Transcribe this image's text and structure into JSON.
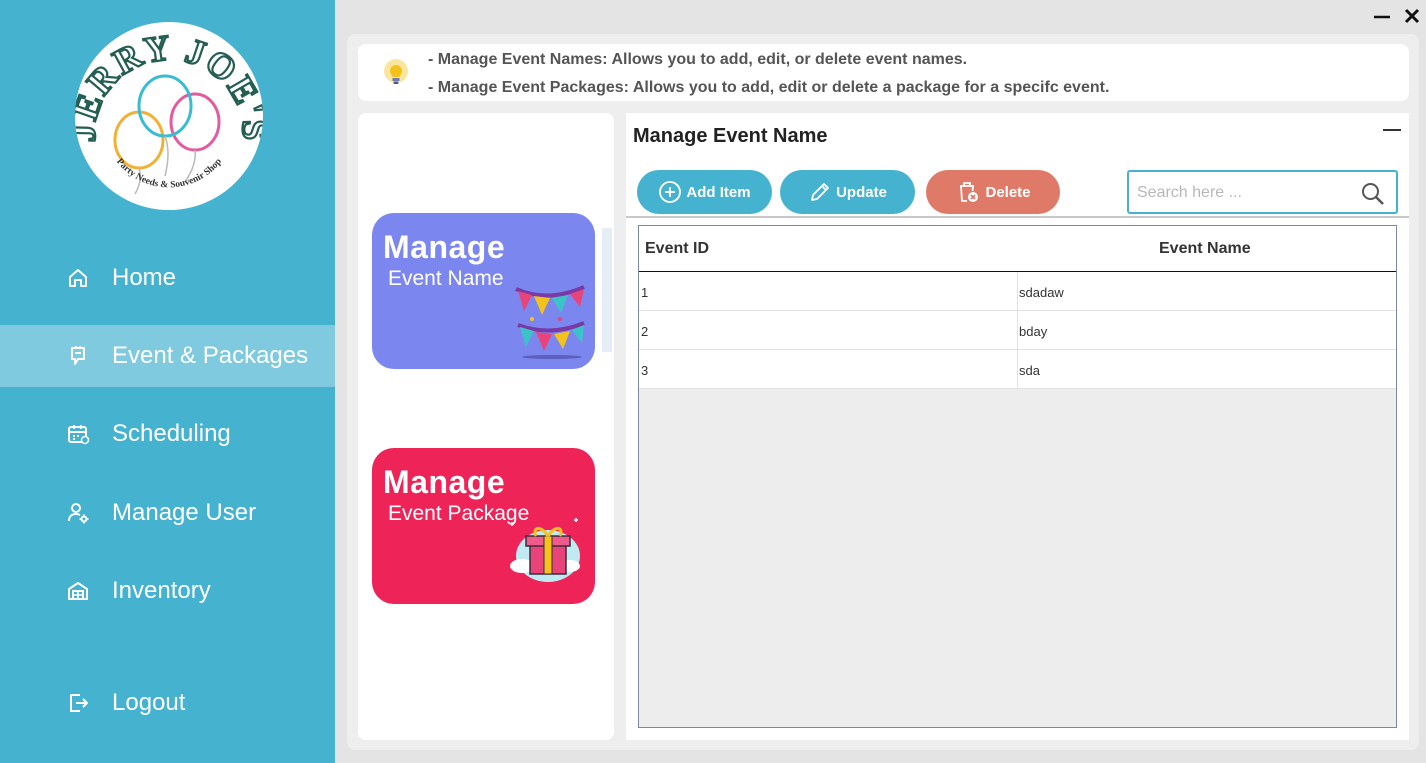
{
  "window": {
    "minimize_icon": "minimize-icon",
    "close_icon": "close-icon"
  },
  "logo": {
    "brand_text": "JERRY JOE'S",
    "tagline": "Party Needs & Souvenir Shop"
  },
  "sidebar": {
    "items": [
      {
        "label": "Home",
        "icon": "home-icon",
        "active": false
      },
      {
        "label": "Event & Packages",
        "icon": "event-packages-icon",
        "active": true
      },
      {
        "label": "Scheduling",
        "icon": "calendar-icon",
        "active": false
      },
      {
        "label": "Manage User",
        "icon": "user-settings-icon",
        "active": false
      },
      {
        "label": "Inventory",
        "icon": "warehouse-icon",
        "active": false
      }
    ],
    "logout": {
      "label": "Logout",
      "icon": "logout-icon"
    }
  },
  "info": {
    "icon": "lightbulb-icon",
    "line1": "- Manage Event Names: Allows you to add, edit, or delete event names.",
    "line2": "- Manage Event Packages: Allows you to add, edit or delete a package for a specifc event."
  },
  "cards": [
    {
      "title": "Manage",
      "subtitle": "Event Name",
      "color": "#7b86ee",
      "icon": "bunting-icon"
    },
    {
      "title": "Manage",
      "subtitle": "Event Package",
      "color": "#ee2358",
      "icon": "gift-box-icon"
    }
  ],
  "content": {
    "title": "Manage Event Name",
    "collapse_icon": "collapse-icon",
    "buttons": {
      "add": {
        "label": "Add Item",
        "color": "#45b2cf",
        "icon": "plus-circle-icon"
      },
      "update": {
        "label": "Update",
        "color": "#45b2cf",
        "icon": "pencil-icon"
      },
      "delete": {
        "label": "Delete",
        "color": "#e07a68",
        "icon": "trash-icon"
      }
    },
    "search": {
      "placeholder": "Search here ...",
      "value": "",
      "icon": "search-icon"
    },
    "table": {
      "columns": [
        "Event ID",
        "Event Name"
      ],
      "rows": [
        [
          "1",
          "sdadaw"
        ],
        [
          "2",
          "bday"
        ],
        [
          "3",
          "sda"
        ]
      ]
    }
  },
  "colors": {
    "sidebar": "#45b2cf",
    "sidebar_active": "#7fcade",
    "accent": "#45b2cf",
    "danger": "#e07a68"
  }
}
